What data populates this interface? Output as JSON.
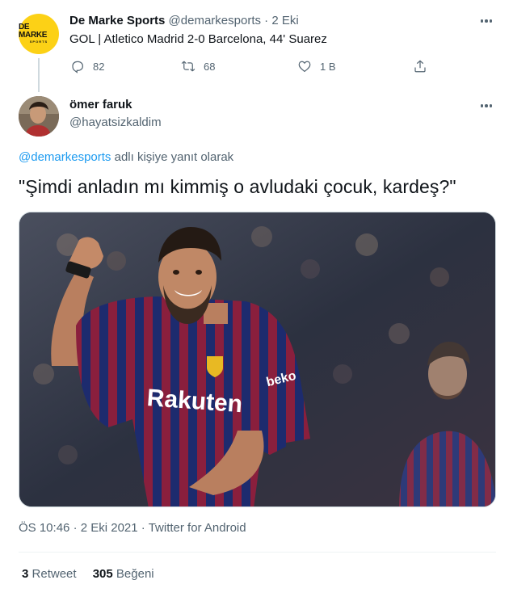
{
  "parent": {
    "avatar_logo_main": "DE MARKE",
    "avatar_logo_sub": "SPORTS",
    "name": "De Marke Sports",
    "handle": "@demarkesports",
    "dot": "·",
    "date": "2 Eki",
    "text": "GOL | Atletico Madrid 2-0 Barcelona, 44' Suarez",
    "replies": "82",
    "retweets": "68",
    "likes": "1 B"
  },
  "reply": {
    "name": "ömer faruk",
    "handle": "@hayatsizkaldim",
    "reply_mention": "@demarkesports",
    "reply_suffix": "adlı kişiye yanıt olarak",
    "text": "\"Şimdi anladın mı kimmiş o avludaki çocuk, kardeş?\"",
    "photo_sponsor": "Rakuten",
    "photo_sleeve": "beko",
    "time": "ÖS 10:46",
    "dot": "·",
    "date": "2 Eki 2021",
    "client": "Twitter for Android",
    "retweet_count": "3",
    "retweet_label": "Retweet",
    "like_count": "305",
    "like_label": "Beğeni"
  },
  "icons": {
    "reply": "reply-icon",
    "retweet": "retweet-icon",
    "like": "heart-icon",
    "share": "share-icon",
    "more": "more-icon"
  },
  "colors": {
    "link": "#1d9bf0",
    "secondary_text": "#536471",
    "primary_text": "#0f1419",
    "brand_yellow": "#fcd116"
  }
}
